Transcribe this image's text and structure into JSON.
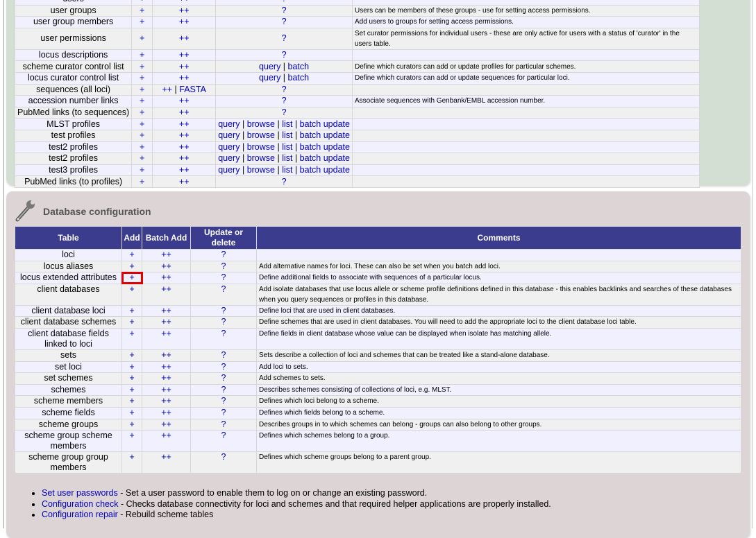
{
  "top_section": {
    "rows": [
      {
        "table": "users",
        "add": "+",
        "batch": "++",
        "update": [
          "?"
        ],
        "comment": ""
      },
      {
        "table": "user groups",
        "add": "+",
        "batch": "++",
        "update": [
          "?"
        ],
        "comment": "Users can be members of these groups - use for setting access permissions."
      },
      {
        "table": "user group members",
        "add": "+",
        "batch": "++",
        "update": [
          "?"
        ],
        "comment": "Add users to groups for setting access permissions."
      },
      {
        "table": "user permissions",
        "add": "+",
        "batch": "++",
        "update": [
          "?"
        ],
        "comment": "Set curator permissions for individual users - these are only active for users with a status of 'curator' in the users table."
      },
      {
        "table": "locus descriptions",
        "add": "+",
        "batch": "++",
        "update": [
          "?"
        ],
        "comment": ""
      },
      {
        "table": "scheme curator control list",
        "add": "+",
        "batch": "++",
        "update": [
          "query",
          "batch"
        ],
        "comment": "Define which curators can add or update profiles for particular schemes."
      },
      {
        "table": "locus curator control list",
        "add": "+",
        "batch": "++",
        "update": [
          "query",
          "batch"
        ],
        "comment": "Define which curators can add or update sequences for particular loci."
      },
      {
        "table": "sequences (all loci)",
        "add": "+",
        "batch": "++",
        "batch_extra": "FASTA",
        "update": [
          "?"
        ],
        "comment": ""
      },
      {
        "table": "accession number links",
        "add": "+",
        "batch": "++",
        "update": [
          "?"
        ],
        "comment": "Associate sequences with Genbank/EMBL accession number."
      },
      {
        "table": "PubMed links (to sequences)",
        "add": "+",
        "batch": "++",
        "update": [
          "?"
        ],
        "comment": ""
      },
      {
        "table": "MLST profiles",
        "add": "+",
        "batch": "++",
        "update": [
          "query",
          "browse",
          "list",
          "batch update"
        ],
        "comment": ""
      },
      {
        "table": "test profiles",
        "add": "+",
        "batch": "++",
        "update": [
          "query",
          "browse",
          "list",
          "batch update"
        ],
        "comment": ""
      },
      {
        "table": "test2 profiles",
        "add": "+",
        "batch": "++",
        "update": [
          "query",
          "browse",
          "list",
          "batch update"
        ],
        "comment": ""
      },
      {
        "table": "test2 profiles",
        "add": "+",
        "batch": "++",
        "update": [
          "query",
          "browse",
          "list",
          "batch update"
        ],
        "comment": ""
      },
      {
        "table": "test3 profiles",
        "add": "+",
        "batch": "++",
        "update": [
          "query",
          "browse",
          "list",
          "batch update"
        ],
        "comment": ""
      },
      {
        "table": "PubMed links (to profiles)",
        "add": "+",
        "batch": "++",
        "update": [
          "?"
        ],
        "comment": ""
      }
    ]
  },
  "db_config": {
    "title": "Database configuration",
    "icon": "wrench-icon",
    "headers": {
      "table": "Table",
      "add": "Add",
      "batch": "Batch Add",
      "update": "Update or delete",
      "comments": "Comments"
    },
    "highlighted_row": 2,
    "rows": [
      {
        "table": "loci",
        "add": "+",
        "batch": "++",
        "update": "?",
        "comment": ""
      },
      {
        "table": "locus aliases",
        "add": "+",
        "batch": "++",
        "update": "?",
        "comment": "Add alternative names for loci. These can also be set when you batch add loci."
      },
      {
        "table": "locus extended attributes",
        "add": "+",
        "batch": "++",
        "update": "?",
        "comment": "Define additional fields to associate with sequences of a particular locus."
      },
      {
        "table": "client databases",
        "add": "+",
        "batch": "++",
        "update": "?",
        "comment": "Add isolate databases that use locus allele or scheme profile definitions defined in this database - this enables backlinks and searches of these databases when you query sequences or profiles in this database."
      },
      {
        "table": "client database loci",
        "add": "+",
        "batch": "++",
        "update": "?",
        "comment": "Define loci that are used in client databases."
      },
      {
        "table": "client database schemes",
        "add": "+",
        "batch": "++",
        "update": "?",
        "comment": "Define schemes that are used in client databases. You will need to add the appropriate loci to the client database loci table."
      },
      {
        "table": "client database fields linked to loci",
        "add": "+",
        "batch": "++",
        "update": "?",
        "comment": "Define fields in client database whose value can be displayed when isolate has matching allele."
      },
      {
        "table": "sets",
        "add": "+",
        "batch": "++",
        "update": "?",
        "comment": "Sets describe a collection of loci and schemes that can be treated like a stand-alone database."
      },
      {
        "table": "set loci",
        "add": "+",
        "batch": "++",
        "update": "?",
        "comment": "Add loci to sets."
      },
      {
        "table": "set schemes",
        "add": "+",
        "batch": "++",
        "update": "?",
        "comment": "Add schemes to sets."
      },
      {
        "table": "schemes",
        "add": "+",
        "batch": "++",
        "update": "?",
        "comment": "Describes schemes consisting of collections of loci, e.g. MLST."
      },
      {
        "table": "scheme members",
        "add": "+",
        "batch": "++",
        "update": "?",
        "comment": "Defines which loci belong to a scheme."
      },
      {
        "table": "scheme fields",
        "add": "+",
        "batch": "++",
        "update": "?",
        "comment": "Defines which fields belong to a scheme."
      },
      {
        "table": "scheme groups",
        "add": "+",
        "batch": "++",
        "update": "?",
        "comment": "Describes groups in to which schemes can belong - groups can also belong to other groups."
      },
      {
        "table": "scheme group scheme members",
        "add": "+",
        "batch": "++",
        "update": "?",
        "comment": "Defines which schemes belong to a group."
      },
      {
        "table": "scheme group group members",
        "add": "+",
        "batch": "++",
        "update": "?",
        "comment": "Defines which scheme groups belong to a parent group."
      }
    ],
    "links": [
      {
        "label": "Set user passwords",
        "desc": " - Set a user password to enable them to log on or change an existing password."
      },
      {
        "label": "Configuration check",
        "desc": " - Checks database connectivity for loci and schemes and that required helper applications are properly installed."
      },
      {
        "label": "Configuration repair",
        "desc": " - Rebuild scheme tables"
      }
    ]
  },
  "colors": {
    "header_bg": "#3c3c8e",
    "link": "#0000bb",
    "highlight": "#e00000",
    "green_box": "#d4dfd3",
    "pink_box": "#ddd5d5"
  }
}
